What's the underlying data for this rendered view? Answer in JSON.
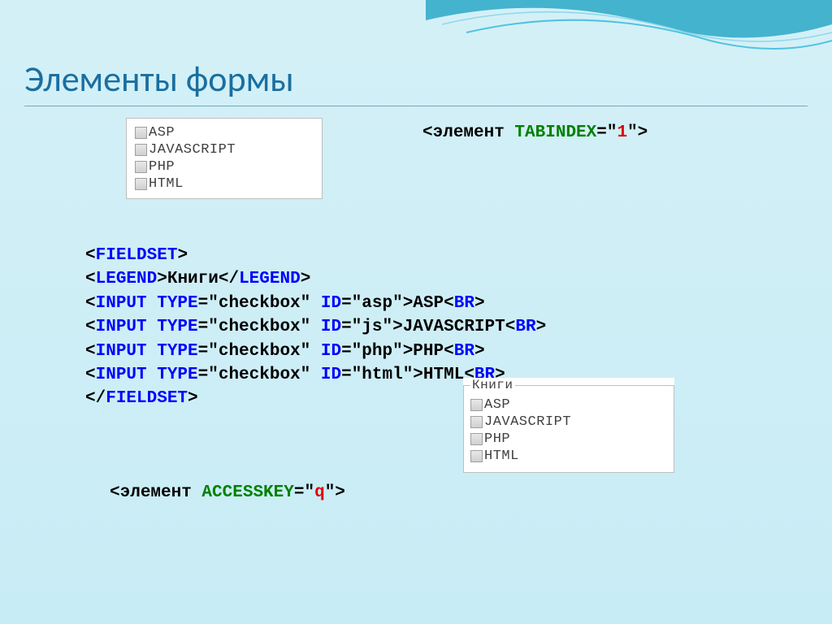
{
  "title": "Элементы формы",
  "checkbox_items": [
    "ASP",
    "JAVASCRIPT",
    "PHP",
    "HTML"
  ],
  "tabindex": {
    "open": "<",
    "elem": "элемент",
    "attr": " TABINDEX",
    "eq": "=\"",
    "val": "1",
    "close": "\">"
  },
  "code": {
    "l1a": "<",
    "l1b": "FIELDSET",
    "l1c": ">",
    "l2a": "<",
    "l2b": "LEGEND",
    "l2c": ">",
    "l2d": "Книги",
    "l2e": "</",
    "l2f": "LEGEND",
    "l2g": ">",
    "l3a": "<",
    "l3b": "INPUT TYPE",
    "l3c": "=\"checkbox\" ",
    "l3d": "ID",
    "l3e": "=\"asp\">ASP<",
    "l3f": "BR",
    "l3g": ">",
    "l4a": "<",
    "l4b": "INPUT TYPE",
    "l4c": "=\"checkbox\" ",
    "l4d": "ID",
    "l4e": "=\"js\">JAVASCRIPT<",
    "l4f": "BR",
    "l4g": ">",
    "l5a": "<",
    "l5b": "INPUT TYPE",
    "l5c": "=\"checkbox\" ",
    "l5d": "ID",
    "l5e": "=\"php\">PHP<",
    "l5f": "BR",
    "l5g": ">",
    "l6a": "<",
    "l6b": "INPUT TYPE",
    "l6c": "=\"checkbox\" ",
    "l6d": "ID",
    "l6e": "=\"html\">HTML<",
    "l6f": "BR",
    "l6g": ">",
    "l7a": "</",
    "l7b": "FIELDSET",
    "l7c": ">"
  },
  "fieldset_legend": "Книги",
  "fieldset_items": [
    "ASP",
    "JAVASCRIPT",
    "PHP",
    "HTML"
  ],
  "accesskey": {
    "open": "<",
    "elem": "элемент",
    "attr": " ACCESSKEY",
    "eq": "=\"",
    "val": "q",
    "close": "\">"
  }
}
